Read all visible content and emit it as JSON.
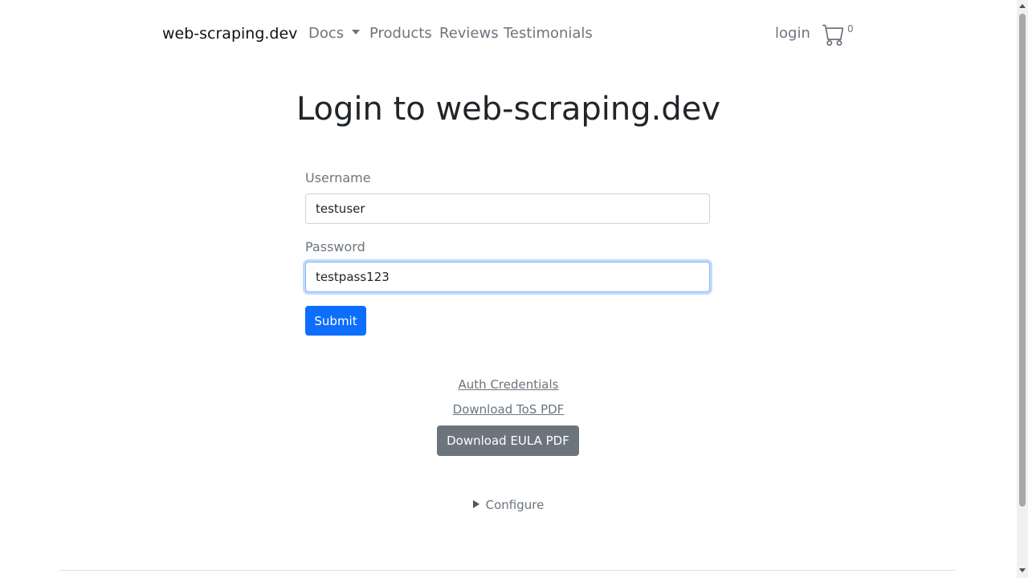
{
  "nav": {
    "brand": "web-scraping.dev",
    "docs": "Docs",
    "products": "Products",
    "reviews": "Reviews",
    "testimonials": "Testimonials",
    "login": "login",
    "cart_icon": "cart-icon",
    "cart_count": "0"
  },
  "main": {
    "title": "Login to web-scraping.dev"
  },
  "form": {
    "username_label": "Username",
    "username_value": "testuser",
    "password_label": "Password",
    "password_value": "testpass123",
    "submit_label": "Submit"
  },
  "links": {
    "auth_credentials": "Auth Credentials",
    "download_tos": "Download ToS PDF",
    "download_eula": "Download EULA PDF"
  },
  "configure": {
    "label": "Configure"
  },
  "colors": {
    "primary": "#0d6efd",
    "secondary": "#6c757d",
    "focus_border": "#86b7fe"
  }
}
